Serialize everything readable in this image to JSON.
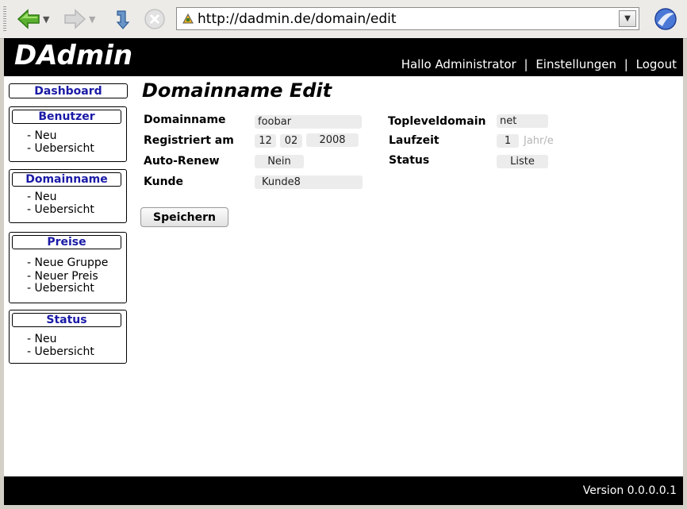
{
  "browser": {
    "url": "http://dadmin.de/domain/edit"
  },
  "header": {
    "brand": "DAdmin",
    "greeting": "Hallo Administrator",
    "settings": "Einstellungen",
    "logout": "Logout",
    "separator": "|"
  },
  "sidebar": {
    "dashboard": "Dashboard",
    "boxes": [
      {
        "title": "Benutzer",
        "items": [
          "- Neu",
          "- Uebersicht"
        ]
      },
      {
        "title": "Domainname",
        "items": [
          "- Neu",
          "- Uebersicht"
        ]
      },
      {
        "title": "Preise",
        "items": [
          "- Neue Gruppe",
          "- Neuer Preis",
          "- Uebersicht"
        ]
      },
      {
        "title": "Status",
        "items": [
          "- Neu",
          "- Uebersicht"
        ]
      }
    ]
  },
  "main": {
    "title": "Domainname Edit",
    "labels": {
      "domainname": "Domainname",
      "registriert": "Registriert am",
      "autorenew": "Auto-Renew",
      "kunde": "Kunde",
      "tld": "Topleveldomain",
      "laufzeit": "Laufzeit",
      "status": "Status"
    },
    "values": {
      "domainname": "foobar",
      "reg_day": "12",
      "reg_month": "02",
      "reg_year": "2008",
      "autorenew": "Nein",
      "kunde": "Kunde8",
      "tld": "net",
      "laufzeit": "1",
      "laufzeit_unit": "Jahr/e",
      "status": "Liste"
    },
    "save_label": "Speichern"
  },
  "footer": {
    "version": "Version 0.0.0.0.1"
  },
  "colors": {
    "header_bg": "#000000",
    "menu_title": "#1a1aa6"
  }
}
